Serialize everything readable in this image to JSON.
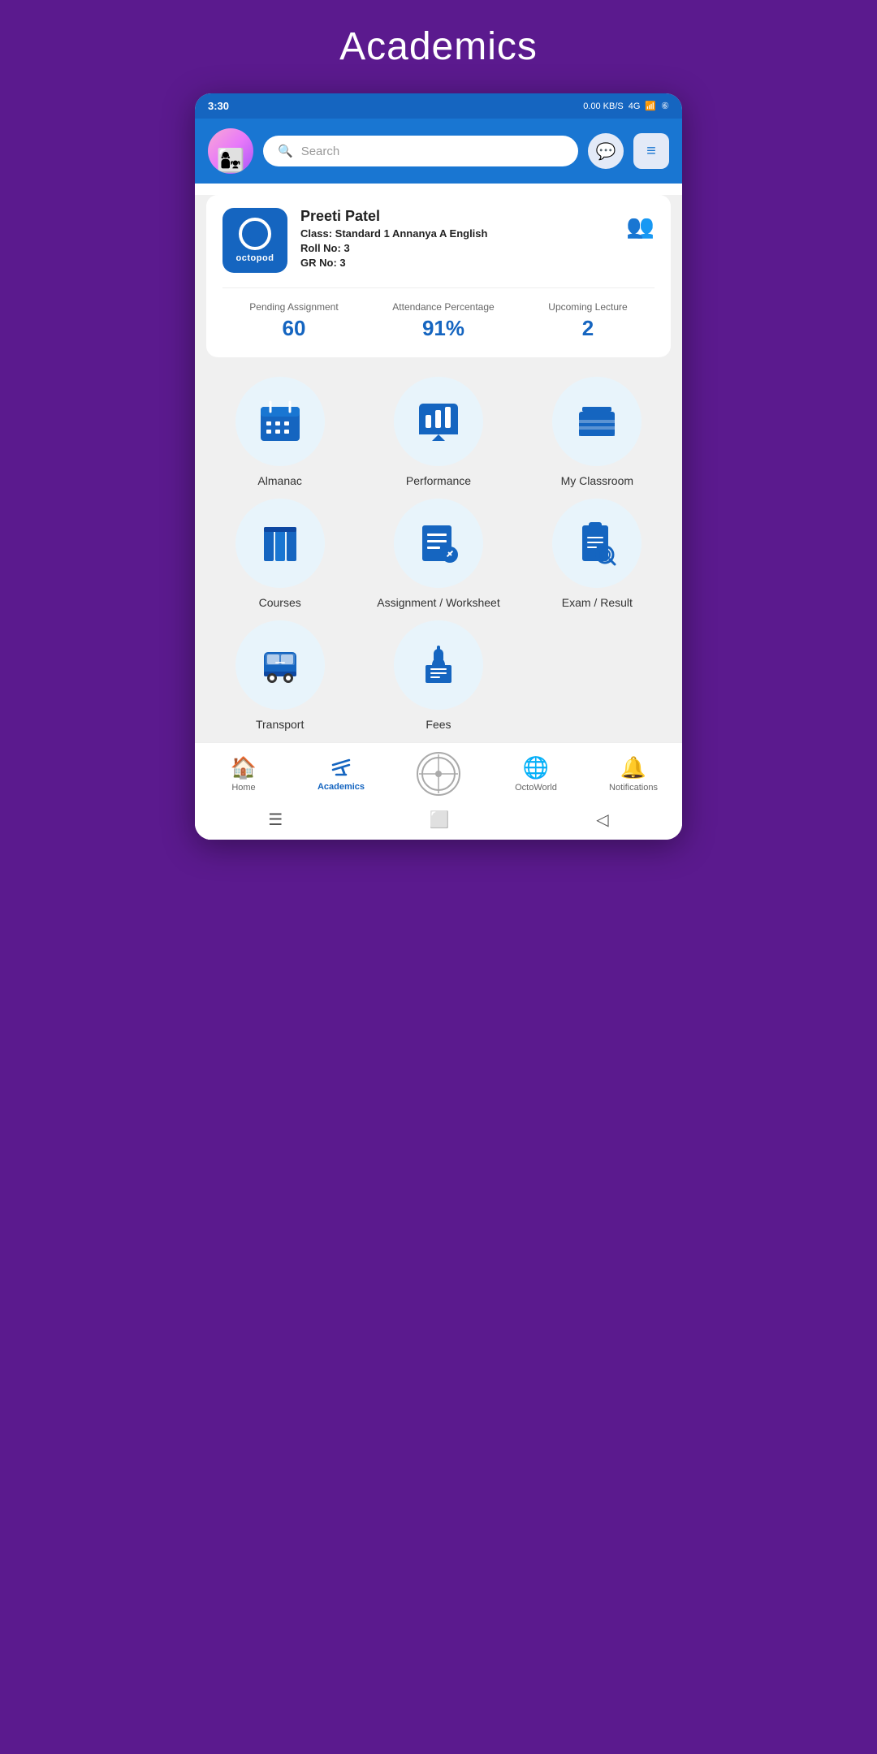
{
  "page": {
    "title": "Academics"
  },
  "statusBar": {
    "time": "3:30",
    "network": "0.00 KB/S",
    "carrier": "4G",
    "battery": "⑥"
  },
  "header": {
    "searchPlaceholder": "Search",
    "chatBtn": "💬",
    "menuBtn": "≡"
  },
  "profile": {
    "appName": "octopod",
    "name": "Preeti Patel",
    "classLabel": "Class:",
    "classValue": "Standard 1 Annanya A English",
    "rollLabel": "Roll No:",
    "rollValue": "3",
    "grLabel": "GR No:",
    "grValue": "3"
  },
  "stats": [
    {
      "label": "Pending Assignment",
      "value": "60"
    },
    {
      "label": "Attendance Percentage",
      "value": "91%"
    },
    {
      "label": "Upcoming Lecture",
      "value": "2"
    }
  ],
  "menuItems": [
    {
      "id": "almanac",
      "label": "Almanac",
      "icon": "📅"
    },
    {
      "id": "performance",
      "label": "Performance",
      "icon": "📊"
    },
    {
      "id": "my-classroom",
      "label": "My Classroom",
      "icon": "📚"
    },
    {
      "id": "courses",
      "label": "Courses",
      "icon": "📖"
    },
    {
      "id": "assignment-worksheet",
      "label": "Assignment / Worksheet",
      "icon": "📝"
    },
    {
      "id": "exam-result",
      "label": "Exam / Result",
      "icon": "🔍"
    },
    {
      "id": "transport",
      "label": "Transport",
      "icon": "🚌"
    },
    {
      "id": "fees",
      "label": "Fees",
      "icon": "🎓"
    }
  ],
  "bottomNav": [
    {
      "id": "home",
      "label": "Home",
      "icon": "🏠",
      "active": false
    },
    {
      "id": "academics",
      "label": "Academics",
      "icon": "✏",
      "active": true
    },
    {
      "id": "octoworld-center",
      "label": "",
      "icon": "⊕",
      "active": false
    },
    {
      "id": "octoworld",
      "label": "OctoWorld",
      "icon": "🌐",
      "active": false
    },
    {
      "id": "notifications",
      "label": "Notifications",
      "icon": "🔔",
      "active": false
    }
  ],
  "androidNav": [
    {
      "id": "menu-btn",
      "icon": "☰"
    },
    {
      "id": "home-btn",
      "icon": "⬜"
    },
    {
      "id": "back-btn",
      "icon": "◁"
    }
  ]
}
